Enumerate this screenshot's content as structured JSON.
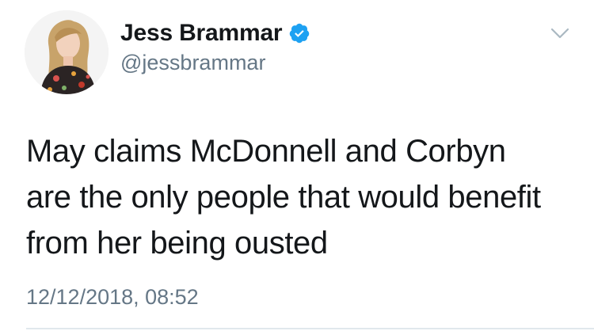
{
  "user": {
    "display_name": "Jess Brammar",
    "handle": "@jessbrammar",
    "verified": true,
    "avatar_icon": "profile-photo"
  },
  "tweet": {
    "lines": [
      "May claims McDonnell and Corbyn",
      "are the only people that would benefit",
      "from her being ousted"
    ],
    "timestamp": "12/12/2018, 08:52"
  },
  "icons": {
    "verified": "verified-badge-icon",
    "menu": "chevron-down-icon"
  },
  "colors": {
    "verified_blue": "#1da1f2",
    "secondary_text": "#657786",
    "primary_text": "#14171a"
  }
}
